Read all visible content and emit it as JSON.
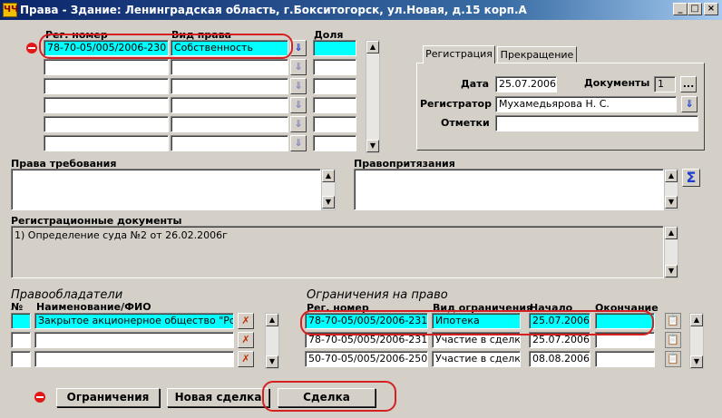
{
  "window": {
    "title": "Права - Здание: Ленинградская область, г.Бокситогорск, ул.Новая, д.15 корп.А",
    "app_icon": "ЧЧ",
    "minimize": "_",
    "maximize": "□",
    "close": "×"
  },
  "rights": {
    "col_reg": "Рег. номер",
    "col_type": "Вид права",
    "col_share": "Доля",
    "rows": [
      {
        "reg": "78-70-05/005/2006-230",
        "type": "Собственность",
        "share": ""
      },
      {
        "reg": "",
        "type": "",
        "share": ""
      },
      {
        "reg": "",
        "type": "",
        "share": ""
      },
      {
        "reg": "",
        "type": "",
        "share": ""
      },
      {
        "reg": "",
        "type": "",
        "share": ""
      },
      {
        "reg": "",
        "type": "",
        "share": ""
      }
    ]
  },
  "tabs": {
    "registration": "Регистрация",
    "termination": "Прекращение"
  },
  "registration": {
    "date_label": "Дата",
    "date": "25.07.2006",
    "docs_label": "Документы",
    "docs_count": "1",
    "docs_btn": "...",
    "registrar_label": "Регистратор",
    "registrar": "Мухамедьярова Н. С.",
    "notes_label": "Отметки",
    "notes": ""
  },
  "claims": {
    "label": "Права требования",
    "value": ""
  },
  "pretensions": {
    "label": "Правопритязания",
    "value": "",
    "sum_icon": "Σ"
  },
  "reg_docs": {
    "label": "Регистрационные документы",
    "value": "1) Определение суда №2 от 26.02.2006г"
  },
  "holders": {
    "section": "Правообладатели",
    "col_no": "№",
    "col_name": "Наименование/ФИО",
    "rows": [
      {
        "no": "",
        "name": "Закрытое акционерное общество \"Рома"
      },
      {
        "no": "",
        "name": ""
      },
      {
        "no": "",
        "name": ""
      }
    ]
  },
  "restrictions": {
    "section": "Ограничения на право",
    "col_reg": "Рег. номер",
    "col_type": "Вид ограничения",
    "col_start": "Начало",
    "col_end": "Окончание",
    "rows": [
      {
        "reg": "78-70-05/005/2006-231",
        "type": "Ипотека",
        "start": "25.07.2006",
        "end": ""
      },
      {
        "reg": "78-70-05/005/2006-231",
        "type": "Участие в сделке",
        "start": "25.07.2006",
        "end": ""
      },
      {
        "reg": "50-70-05/005/2006-250",
        "type": "Участие в сделке",
        "start": "08.08.2006",
        "end": ""
      }
    ]
  },
  "buttons": {
    "restrictions": "Ограничения",
    "new_deal": "Новая сделка",
    "deal": "Сделка"
  },
  "icons": {
    "arrow_down": "⇓",
    "scroll_up": "▲",
    "scroll_down": "▼",
    "clipboard": "📋",
    "delete_x": "✗"
  }
}
